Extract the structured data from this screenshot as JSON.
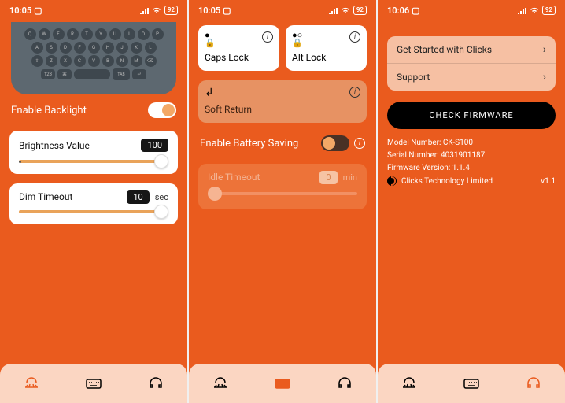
{
  "status": {
    "time1": "10:05",
    "time2": "10:05",
    "time3": "10:06",
    "battery": "92"
  },
  "screen1": {
    "keys_row1": [
      "Q",
      "W",
      "E",
      "R",
      "T",
      "Y",
      "U",
      "I",
      "O",
      "P"
    ],
    "keys_row2": [
      "A",
      "S",
      "D",
      "F",
      "G",
      "H",
      "J",
      "K",
      "L"
    ],
    "keys_row3": [
      "⇧",
      "Z",
      "X",
      "C",
      "V",
      "B",
      "N",
      "M",
      "⌫"
    ],
    "tab_label": "TAB",
    "enable_label": "Enable Backlight",
    "brightness_label": "Brightness Value",
    "brightness_value": "100",
    "dim_label": "Dim Timeout",
    "dim_value": "10",
    "dim_unit": "sec"
  },
  "screen2": {
    "caps_label": "Caps Lock",
    "alt_label": "Alt Lock",
    "soft_label": "Soft Return",
    "battery_saving_label": "Enable Battery Saving",
    "idle_label": "Idle Timeout",
    "idle_value": "0",
    "idle_unit": "min"
  },
  "screen3": {
    "item1": "Get Started with Clicks",
    "item2": "Support",
    "firmware_btn": "CHECK FIRMWARE",
    "model_label": "Model Number: CK-S100",
    "serial_label": "Serial Number: 4031901187",
    "fw_label": "Firmware Version: 1.1.4",
    "company": "Clicks Technology Limited",
    "app_version": "v1.1"
  }
}
